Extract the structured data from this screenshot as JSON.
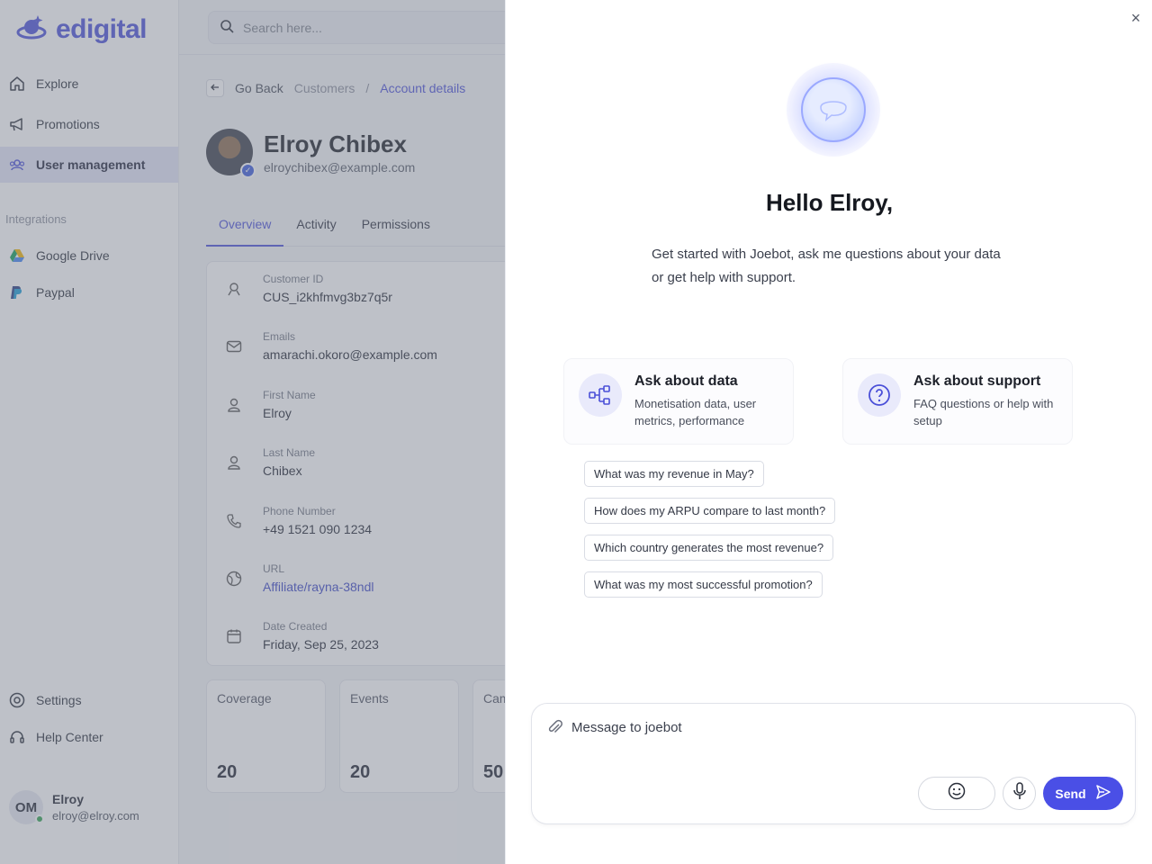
{
  "sidebar": {
    "logo_text": "edigital",
    "nav": [
      {
        "label": "Explore"
      },
      {
        "label": "Promotions"
      },
      {
        "label": "User management"
      }
    ],
    "integrations_label": "Integrations",
    "integrations": [
      {
        "label": "Google Drive"
      },
      {
        "label": "Paypal"
      }
    ],
    "bottom": [
      {
        "label": "Settings"
      },
      {
        "label": "Help Center"
      }
    ],
    "user": {
      "initials": "OM",
      "name": "Elroy",
      "email": "elroy@elroy.com"
    }
  },
  "search": {
    "placeholder": "Search here..."
  },
  "breadcrumb": {
    "back": "Go Back",
    "parent": "Customers",
    "separator": "/",
    "current": "Account details"
  },
  "profile": {
    "name": "Elroy Chibex",
    "email": "elroychibex@example.com"
  },
  "tabs": [
    {
      "label": "Overview"
    },
    {
      "label": "Activity"
    },
    {
      "label": "Permissions"
    }
  ],
  "details": [
    {
      "label": "Customer ID",
      "value": "CUS_i2khfmvg3bz7q5r"
    },
    {
      "label": "Emails",
      "value": "amarachi.okoro@example.com"
    },
    {
      "label": "First Name",
      "value": "Elroy"
    },
    {
      "label": "Last Name",
      "value": "Chibex"
    },
    {
      "label": "Phone Number",
      "value": "+49 1521 090 1234"
    },
    {
      "label": "URL",
      "value": "Affiliate/rayna-38ndl"
    },
    {
      "label": "Date Created",
      "value": "Friday, Sep 25, 2023"
    }
  ],
  "stats": [
    {
      "label": "Coverage",
      "value": "20"
    },
    {
      "label": "Events",
      "value": "20"
    },
    {
      "label": "Cam",
      "value": "50"
    }
  ],
  "chat": {
    "greeting": "Hello Elroy,",
    "intro": "Get started with Joebot, ask me questions about your data or get help with support.",
    "cards": [
      {
        "title": "Ask about data",
        "desc": "Monetisation data, user metrics, performance"
      },
      {
        "title": "Ask about support",
        "desc": "FAQ questions or help with setup"
      }
    ],
    "suggestions": [
      "What was my revenue in May?",
      "How does my ARPU compare to last month?",
      "Which country generates the most revenue?",
      "What was my most successful promotion?"
    ],
    "composer_placeholder": "Message to joebot",
    "send_label": "Send",
    "close_symbol": "×"
  },
  "colors": {
    "accent": "#4a4fe6",
    "brand": "#4a4fd8",
    "overlay": "#787e8c"
  }
}
